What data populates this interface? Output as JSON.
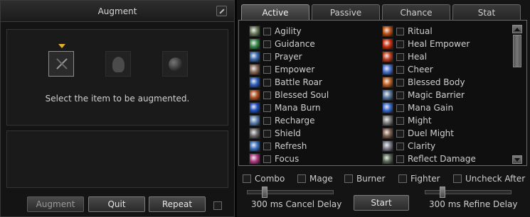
{
  "augment": {
    "title": "Augment",
    "message": "Select the item to be augmented.",
    "slots": [
      "weapon-slot",
      "life-stone-slot",
      "gemstone-slot"
    ],
    "buttons": {
      "augment": "Augment",
      "quit": "Quit",
      "repeat": "Repeat"
    },
    "repeat_checked": false
  },
  "autocast": {
    "tabs": [
      "Active",
      "Passive",
      "Chance",
      "Stat"
    ],
    "active_tab": "Active",
    "skills_left": [
      {
        "name": "Agility",
        "icon": "agility-icon",
        "color": "#6a7a5a"
      },
      {
        "name": "Guidance",
        "icon": "guidance-icon",
        "color": "#3a8a4a"
      },
      {
        "name": "Prayer",
        "icon": "prayer-icon",
        "color": "#3a6ab0"
      },
      {
        "name": "Empower",
        "icon": "empower-icon",
        "color": "#8a6a5a"
      },
      {
        "name": "Battle Roar",
        "icon": "battle-roar-icon",
        "color": "#3060c0"
      },
      {
        "name": "Blessed Soul",
        "icon": "blessed-soul-icon",
        "color": "#b05020"
      },
      {
        "name": "Mana Burn",
        "icon": "mana-burn-icon",
        "color": "#2050c0"
      },
      {
        "name": "Recharge",
        "icon": "recharge-icon",
        "color": "#5a80b0"
      },
      {
        "name": "Shield",
        "icon": "shield-icon",
        "color": "#6a6a6a"
      },
      {
        "name": "Refresh",
        "icon": "refresh-icon",
        "color": "#3a70c0"
      },
      {
        "name": "Focus",
        "icon": "focus-icon",
        "color": "#b03a80"
      }
    ],
    "skills_right": [
      {
        "name": "Ritual",
        "icon": "ritual-icon",
        "color": "#c05010"
      },
      {
        "name": "Heal Empower",
        "icon": "heal-empower-icon",
        "color": "#d03010"
      },
      {
        "name": "Heal",
        "icon": "heal-icon",
        "color": "#c04020"
      },
      {
        "name": "Cheer",
        "icon": "cheer-icon",
        "color": "#4a70d0"
      },
      {
        "name": "Blessed Body",
        "icon": "blessed-body-icon",
        "color": "#c06020"
      },
      {
        "name": "Magic Barrier",
        "icon": "magic-barrier-icon",
        "color": "#5a7aa0"
      },
      {
        "name": "Mana Gain",
        "icon": "mana-gain-icon",
        "color": "#3a6ad0"
      },
      {
        "name": "Might",
        "icon": "might-icon",
        "color": "#7a7a7a"
      },
      {
        "name": "Duel Might",
        "icon": "duel-might-icon",
        "color": "#806050"
      },
      {
        "name": "Clarity",
        "icon": "clarity-icon",
        "color": "#7a7a8a"
      },
      {
        "name": "Reflect Damage",
        "icon": "reflect-damage-icon",
        "color": "#5a6a5a"
      }
    ],
    "options": [
      "Combo",
      "Mage",
      "Burner",
      "Fighter",
      "Uncheck After"
    ],
    "cancel_delay_label": "300 ms Cancel Delay",
    "refine_delay_label": "300 ms Refine Delay",
    "cancel_delay_level": 0.18,
    "refine_delay_level": 0.18,
    "start_label": "Start"
  }
}
